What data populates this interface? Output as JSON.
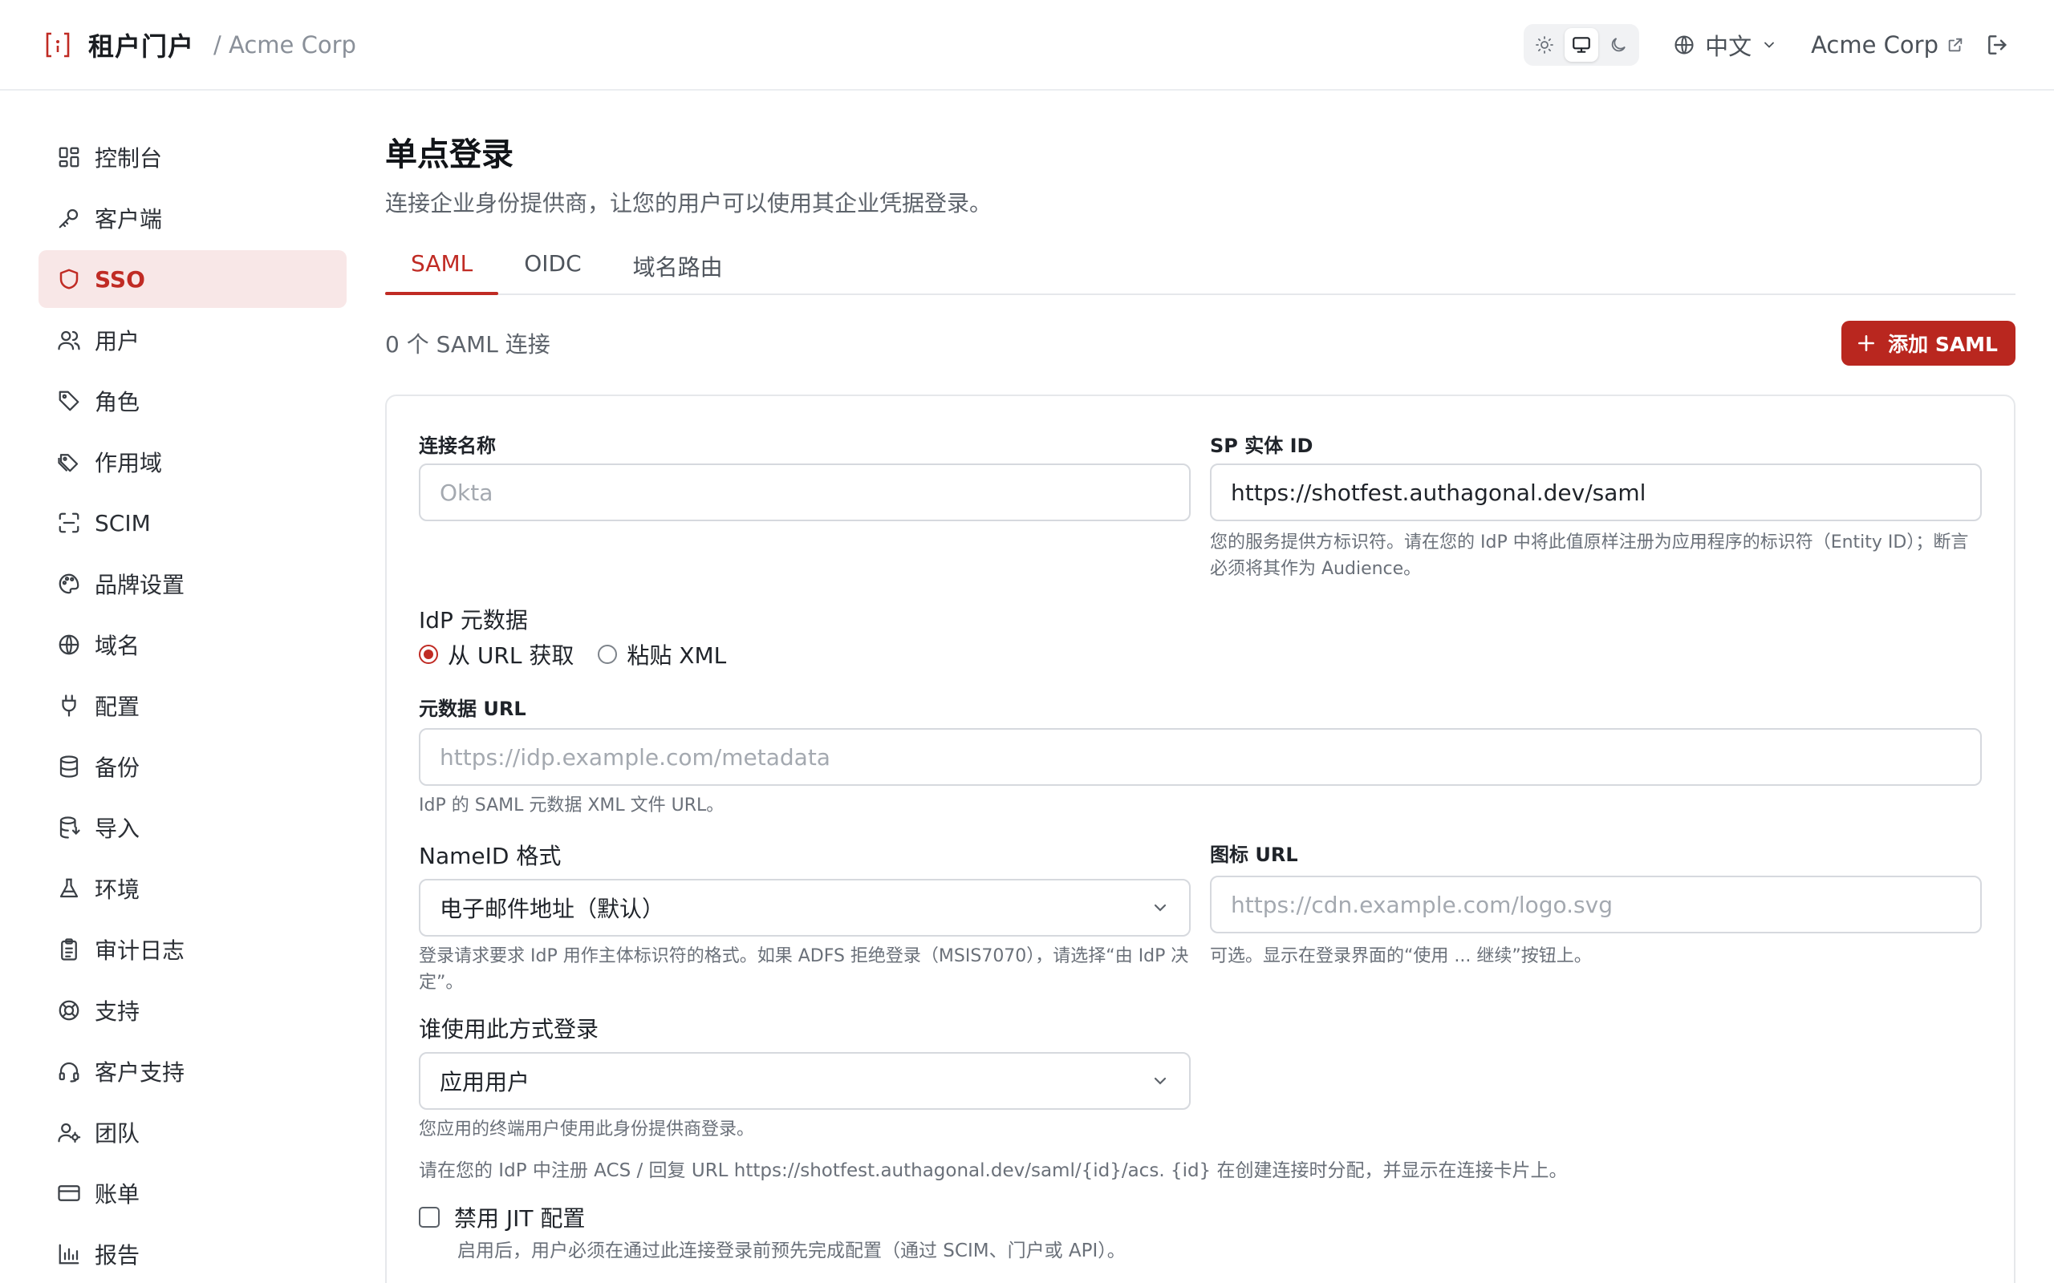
{
  "header": {
    "brand": "租户门户",
    "tenant_crumb": "/ Acme Corp",
    "language": "中文",
    "tenant_link": "Acme Corp"
  },
  "colors": {
    "accent": "#c02b24",
    "accent_bg": "#f8e7e7",
    "button": "#b9271f"
  },
  "sidebar": {
    "items": [
      {
        "label": "控制台",
        "icon": "dashboard-icon"
      },
      {
        "label": "客户端",
        "icon": "key-icon"
      },
      {
        "label": "SSO",
        "icon": "shield-icon",
        "active": true
      },
      {
        "label": "用户",
        "icon": "users-icon"
      },
      {
        "label": "角色",
        "icon": "tag-icon"
      },
      {
        "label": "作用域",
        "icon": "tags-icon"
      },
      {
        "label": "SCIM",
        "icon": "scan-icon"
      },
      {
        "label": "品牌设置",
        "icon": "palette-icon"
      },
      {
        "label": "域名",
        "icon": "globe-icon"
      },
      {
        "label": "配置",
        "icon": "plug-icon"
      },
      {
        "label": "备份",
        "icon": "database-icon"
      },
      {
        "label": "导入",
        "icon": "database-import-icon"
      },
      {
        "label": "环境",
        "icon": "flask-icon"
      },
      {
        "label": "审计日志",
        "icon": "clipboard-icon"
      },
      {
        "label": "支持",
        "icon": "lifebuoy-icon"
      },
      {
        "label": "客户支持",
        "icon": "headset-icon"
      },
      {
        "label": "团队",
        "icon": "team-icon"
      },
      {
        "label": "账单",
        "icon": "credit-card-icon"
      },
      {
        "label": "报告",
        "icon": "bar-chart-icon"
      }
    ]
  },
  "page": {
    "title": "单点登录",
    "description": "连接企业身份提供商，让您的用户可以使用其企业凭据登录。",
    "tabs": [
      "SAML",
      "OIDC",
      "域名路由"
    ],
    "count": "0 个 SAML 连接",
    "add_button": "添加 SAML"
  },
  "form": {
    "connection_name_label": "连接名称",
    "connection_name_placeholder": "Okta",
    "sp_entity_label": "SP 实体 ID",
    "sp_entity_value": "https://shotfest.authagonal.dev/saml",
    "sp_entity_help": "您的服务提供方标识符。请在您的 IdP 中将此值原样注册为应用程序的标识符（Entity ID）；断言必须将其作为 Audience。",
    "idp_metadata_label": "IdP 元数据",
    "radio_url": "从 URL 获取",
    "radio_xml": "粘贴 XML",
    "metadata_url_label": "元数据 URL",
    "metadata_url_placeholder": "https://idp.example.com/metadata",
    "metadata_url_help": "IdP 的 SAML 元数据 XML 文件 URL。",
    "nameid_label": "NameID 格式",
    "nameid_value": "电子邮件地址（默认）",
    "nameid_help": "登录请求要求 IdP 用作主体标识符的格式。如果 ADFS 拒绝登录（MSIS7070），请选择“由 IdP 决定”。",
    "icon_url_label": "图标 URL",
    "icon_url_placeholder": "https://cdn.example.com/logo.svg",
    "icon_url_help": "可选。显示在登录界面的“使用 ... 继续”按钮上。",
    "who_label": "谁使用此方式登录",
    "who_value": "应用用户",
    "who_help": "您应用的终端用户使用此身份提供商登录。",
    "acs_note": "请在您的 IdP 中注册 ACS / 回复 URL https://shotfest.authagonal.dev/saml/{id}/acs. {id} 在创建连接时分配，并显示在连接卡片上。",
    "jit_label": "禁用 JIT 配置",
    "jit_help": "启用后，用户必须在通过此连接登录前预先完成配置（通过 SCIM、门户或 API）。"
  }
}
